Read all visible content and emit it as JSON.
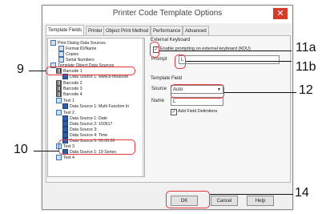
{
  "window": {
    "title": "Printer Code Template Options",
    "close_glyph": "✕"
  },
  "tabs": [
    {
      "label": "Template Fields",
      "active": true
    },
    {
      "label": "Printer",
      "active": false
    },
    {
      "label": "Object Print Method",
      "active": false
    },
    {
      "label": "Performance",
      "active": false
    },
    {
      "label": "Advanced",
      "active": false
    }
  ],
  "tree": {
    "items": [
      {
        "label": "Print Dialog Data Sources",
        "icon": "folder-icon"
      },
      {
        "label": "Format ID/Name",
        "icon": "field-icon"
      },
      {
        "label": "Copies",
        "icon": "field-icon"
      },
      {
        "label": "Serial Numbers",
        "icon": "field-icon"
      },
      {
        "label": "Template Object Data Sources",
        "icon": "folder-icon"
      },
      {
        "label": "Barcode 1",
        "icon": "barcode-icon"
      },
      {
        "label": "Data Source 1: www.8-measure",
        "icon": "doc-icon"
      },
      {
        "label": "Barcode 2",
        "icon": "barcode-icon"
      },
      {
        "label": "Barcode 3",
        "icon": "barcode-icon"
      },
      {
        "label": "Barcode 4",
        "icon": "barcode-icon"
      },
      {
        "label": "Text 1",
        "icon": "text-icon"
      },
      {
        "label": "Data Source 1: Multi Function In",
        "icon": "doc-icon"
      },
      {
        "label": "Text 2",
        "icon": "text-icon"
      },
      {
        "label": "Data Source 1: Date",
        "icon": "doc-icon"
      },
      {
        "label": "Data Source 2: 150617",
        "icon": "doc-icon"
      },
      {
        "label": "Data Source 3:",
        "icon": "doc-icon"
      },
      {
        "label": "Data Source 4: Time",
        "icon": "doc-icon"
      },
      {
        "label": "Data Source 5: 00:00:00",
        "icon": "doc-icon"
      },
      {
        "label": "Text 3",
        "icon": "text-icon"
      },
      {
        "label": "Data Source 1: 19 Series",
        "icon": "doc-icon"
      },
      {
        "label": "Text 4",
        "icon": "text-icon"
      }
    ]
  },
  "external_keyboard": {
    "group_label": "External Keyboard",
    "checkbox_label": "Enable prompting on external keyboard (KDU)",
    "checked": true,
    "prompt_label": "Prompt",
    "prompt_value": "L"
  },
  "template_field": {
    "group_label": "Template Field",
    "source_label": "Source",
    "source_value": "Auto",
    "name_label": "Name",
    "name_value": "L",
    "delimiters_label": "Add Field Delimiters",
    "delimiters_checked": true
  },
  "buttons": {
    "ok": "OK",
    "cancel": "Cancel",
    "help": "Help"
  },
  "callouts": [
    "9",
    "10",
    "11a",
    "11b",
    "12",
    "14"
  ],
  "colors": {
    "highlight": "#e2363c",
    "close_button": "#d43b2a"
  }
}
